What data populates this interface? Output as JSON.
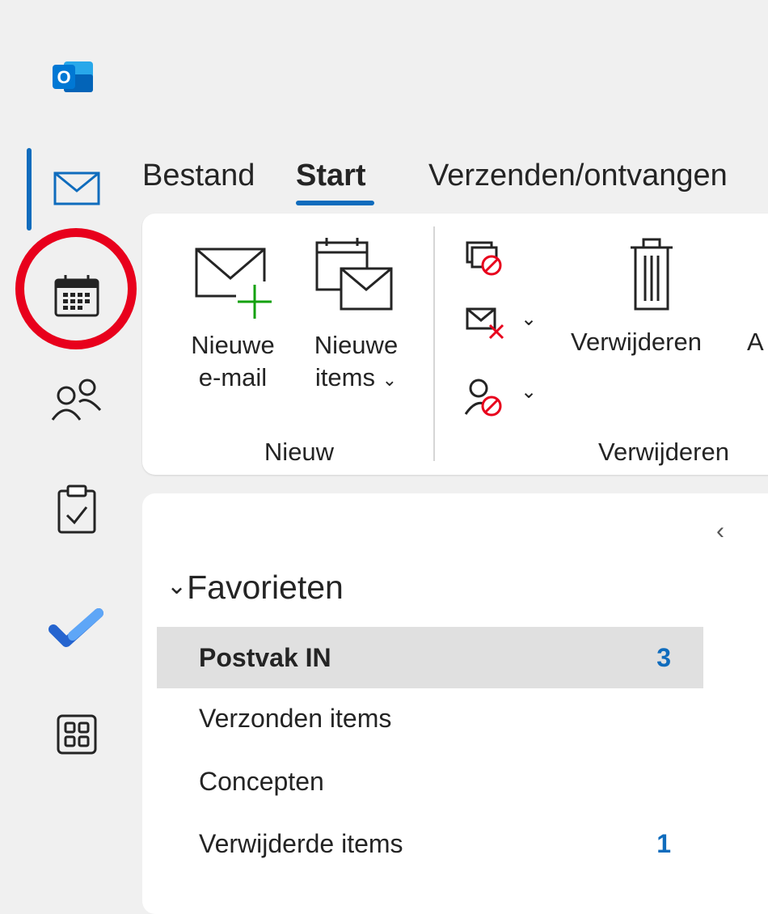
{
  "app": {
    "name": "Outlook",
    "logo_letter": "O"
  },
  "nav": {
    "items": [
      {
        "name": "mail",
        "icon": "mail-icon",
        "active": true
      },
      {
        "name": "calendar",
        "icon": "calendar-icon",
        "highlighted": true
      },
      {
        "name": "people",
        "icon": "people-icon"
      },
      {
        "name": "tasks",
        "icon": "clipboard-check-icon"
      },
      {
        "name": "todo",
        "icon": "todo-check-icon"
      },
      {
        "name": "apps",
        "icon": "apps-grid-icon"
      }
    ],
    "accent": "#0f6cbd",
    "highlight_color": "#e8001c"
  },
  "ribbon": {
    "tabs": [
      {
        "label": "Bestand"
      },
      {
        "label": "Start",
        "active": true
      },
      {
        "label": "Verzenden/ontvangen"
      }
    ],
    "new_mail": {
      "line1": "Nieuwe",
      "line2": "e-mail"
    },
    "new_items": {
      "line1": "Nieuwe",
      "line2": "items",
      "chevron": "⌄"
    },
    "group_new": "Nieuw",
    "delete_button": "Verwijderen",
    "cutoff_letter": "A",
    "group_delete": "Verwijderen",
    "chevron": "⌄"
  },
  "folders": {
    "collapse_glyph": "‹",
    "favorites_header": "Favorieten",
    "favorites_chevron": "⌄",
    "items": [
      {
        "name": "Postvak IN",
        "count": "3",
        "selected": true
      },
      {
        "name": "Verzonden items",
        "count": ""
      },
      {
        "name": "Concepten",
        "count": ""
      },
      {
        "name": "Verwijderde items",
        "count": "1"
      }
    ]
  }
}
